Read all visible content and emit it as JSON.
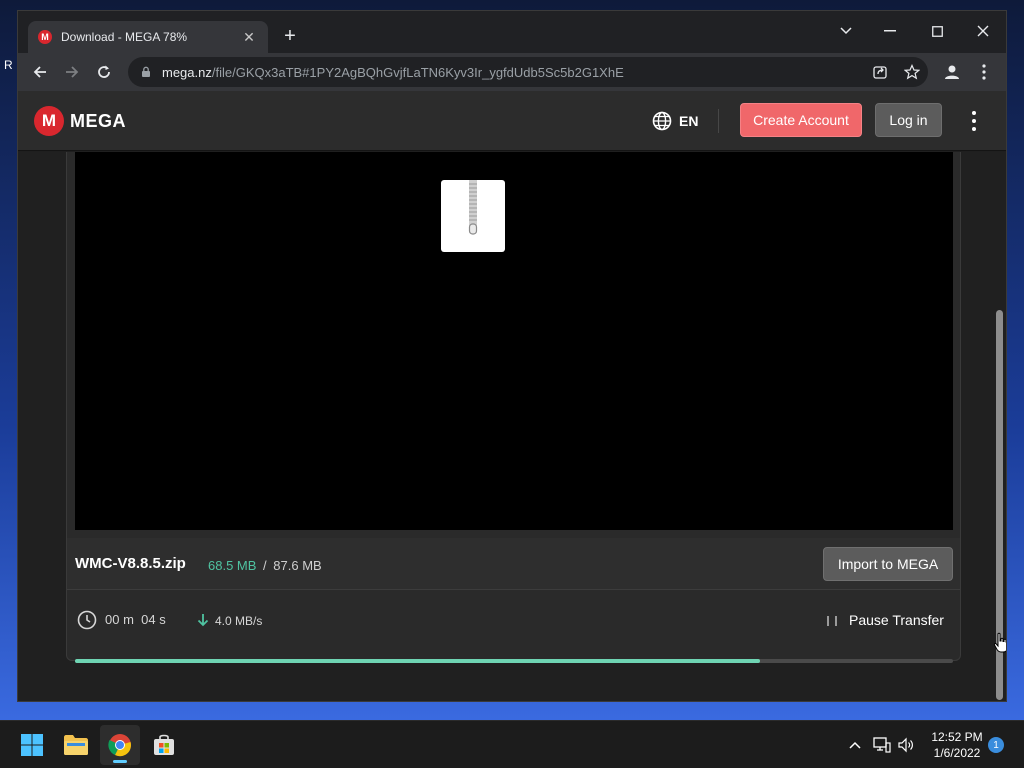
{
  "desktop": {
    "partial_label": "R"
  },
  "tab": {
    "title": "Download - MEGA 78%",
    "favicon_letter": "M"
  },
  "address_bar": {
    "host": "mega.nz",
    "path": "/file/GKQx3aTB#1PY2AgBQhGvjfLaTN6Kyv3Ir_ygfdUdb5Sc5b2G1XhE"
  },
  "header": {
    "logo_letter": "M",
    "logo_text": "MEGA",
    "language": "EN",
    "create_account": "Create Account",
    "login": "Log in"
  },
  "file": {
    "name": "WMC-V8.8.5.zip",
    "downloaded": "68.5 MB",
    "separator": "/",
    "total": "87.6 MB",
    "import_button": "Import to MEGA"
  },
  "transfer": {
    "time_remaining": "00 m  04 s",
    "speed": "4.0 MB/s",
    "pause_label": "Pause Transfer",
    "progress_fraction": 0.78
  },
  "taskbar": {
    "time": "12:52 PM",
    "date": "1/6/2022",
    "notification_count": "1"
  },
  "colors": {
    "mega_red": "#d9272e",
    "create_account": "#f0676a",
    "progress": "#6fd4b3",
    "downloaded_text": "#4fc3a1"
  }
}
